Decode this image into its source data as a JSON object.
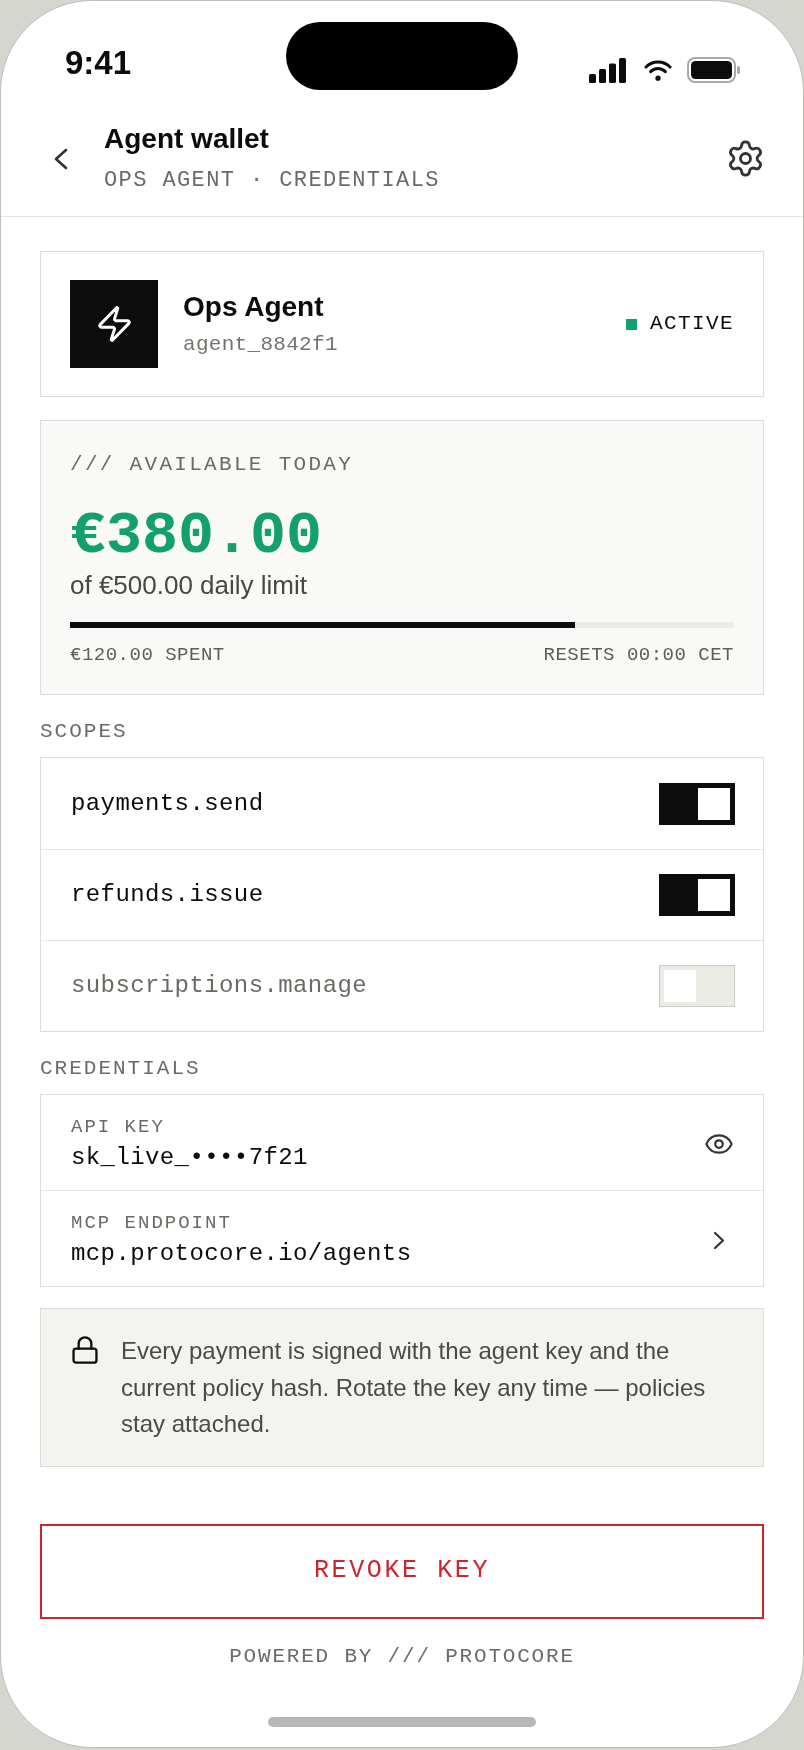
{
  "status_bar": {
    "time": "9:41"
  },
  "header": {
    "title": "Agent wallet",
    "subtitle": "OPS AGENT · CREDENTIALS"
  },
  "agent": {
    "name": "Ops Agent",
    "handle": "agent_8842f1",
    "status": "ACTIVE"
  },
  "balance": {
    "label": "/// AVAILABLE TODAY",
    "amount": "€380.00",
    "limit": "of €500.00 daily limit",
    "level": 0.76,
    "spent": "€120.00 SPENT",
    "resets": "RESETS 00:00 CET"
  },
  "scopes": {
    "title": "SCOPES",
    "items": [
      {
        "name": "payments.send",
        "on": true
      },
      {
        "name": "refunds.issue",
        "on": true
      },
      {
        "name": "subscriptions.manage",
        "on": false
      }
    ]
  },
  "credentials": {
    "title": "CREDENTIALS",
    "items": [
      {
        "kind": "secret",
        "label": "API KEY",
        "value": "sk_live_••••7f21"
      },
      {
        "kind": "link",
        "label": "MCP ENDPOINT",
        "value": "mcp.protocore.io/agents"
      }
    ]
  },
  "notice": "Every payment is signed with the agent key and the current policy hash. Rotate the key any time — policies stay attached.",
  "revoke_button": "REVOKE KEY",
  "footer": "POWERED BY /// PROTOCORE"
}
